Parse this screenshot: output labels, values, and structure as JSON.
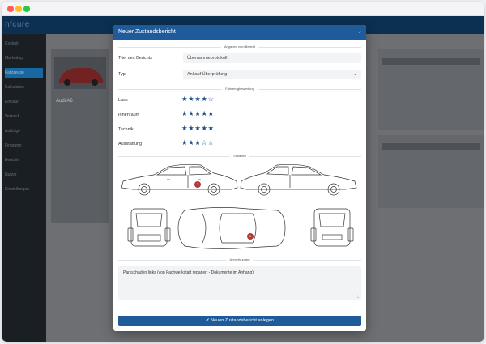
{
  "bg": {
    "logo": "nfcure",
    "sidebar_items": [
      "Cockpit",
      "Marketing",
      "Fahrzeuge",
      "Kalkulation",
      "Einkauf",
      "Verkauf",
      "Aufträge",
      "Finanzen",
      "Berichte",
      "Nutzer",
      "Einstellungen"
    ],
    "vehicle": "Audi A6"
  },
  "modal": {
    "title": "Neuer Zustandsbericht",
    "close_icon": "chevron-down-icon",
    "section_details": "Angaben zum Bericht",
    "title_label": "Titel des Berichts",
    "title_value": "Übernahmeprotokoll",
    "type_label": "Typ",
    "type_value": "Ankauf Überprüfung",
    "section_rating": "Fahrzeugbewertung",
    "ratings": [
      {
        "label": "Lack",
        "stars": 4
      },
      {
        "label": "Innenraum",
        "stars": 5
      },
      {
        "label": "Technik",
        "stars": 5
      },
      {
        "label": "Ausstattung",
        "stars": 3
      }
    ],
    "section_damage": "Schäden",
    "damage_markers": [
      "2",
      "1"
    ],
    "section_notes": "Anmerkungen",
    "notes_value": "Parkschaden links (von Fachwerkstatt repariert - Dokumente im Anhang)",
    "submit_label": "✔ Neuen Zustandsbericht anlegen",
    "accent": "#1f5b9b",
    "marker_color": "#b03a3a"
  }
}
